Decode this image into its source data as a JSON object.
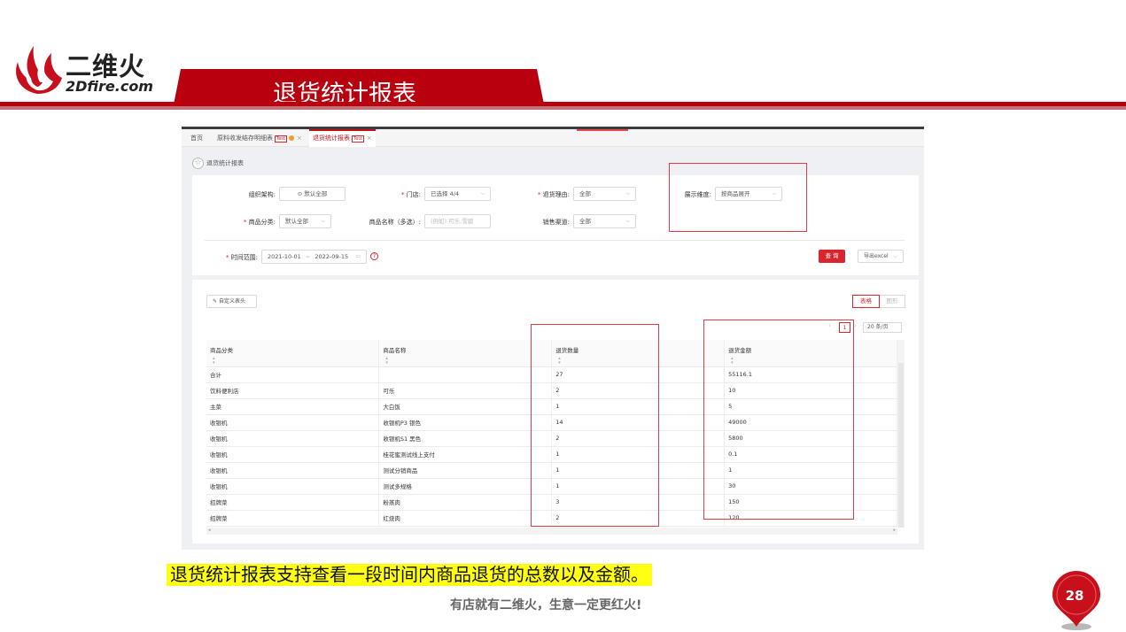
{
  "brand": {
    "name_cn": "二维火",
    "name_en": "2Dfire.com"
  },
  "slide": {
    "title": "退货统计报表",
    "caption": "退货统计报表支持查看一段时间内商品退货的总数以及金额。",
    "slogan": "有店就有二维火，生意一定更红火!",
    "page": "28"
  },
  "colors": {
    "brand_red": "#b8000e",
    "accent_red": "#d7262f",
    "highlight_yellow": "#ffff14"
  },
  "screen": {
    "tabs": [
      {
        "label": "首页"
      },
      {
        "label": "原料收发结存明细表",
        "tag": "Test"
      },
      {
        "label": "退货统计报表",
        "tag": "Test"
      }
    ],
    "breadcrumb": "退货统计报表",
    "filters": {
      "org_label": "组织架构:",
      "org_value": "⊙ 默认全部",
      "store_label": "门店:",
      "store_value": "已选择 4/4",
      "reason_label": "退货理由:",
      "reason_value": "全部",
      "dimension_label": "展示维度:",
      "dimension_value": "按商品展开",
      "category_label": "商品分类:",
      "category_value": "默认全部",
      "name_label": "商品名称（多选）:",
      "name_placeholder": "(例如) 可乐;雪碧",
      "channel_label": "销售渠道:",
      "channel_value": "全部",
      "time_label": "时间范围:",
      "date_start": "2021-10-01",
      "date_sep": "~",
      "date_end": "2022-09-15",
      "query_btn": "查 询",
      "export_btn": "导出excel"
    },
    "toolbar": {
      "custom_header": "自定义表头",
      "view_table": "表格",
      "view_chart": "图形"
    },
    "pager": {
      "current": "1",
      "page_size": "20 条/页"
    },
    "table": {
      "columns": [
        "商品分类",
        "商品名称",
        "退货数量",
        "退货金额"
      ],
      "rows": [
        [
          "合计",
          "",
          "27",
          "55116.1"
        ],
        [
          "饮料便利店",
          "可乐",
          "2",
          "10"
        ],
        [
          "主菜",
          "大白饭",
          "1",
          "5"
        ],
        [
          "收银机",
          "收银机P3 银色",
          "14",
          "49000"
        ],
        [
          "收银机",
          "收银机S1 黑色",
          "2",
          "5800"
        ],
        [
          "收银机",
          "桂花蜜测试线上支付",
          "1",
          "0.1"
        ],
        [
          "收银机",
          "测试分销商品",
          "1",
          "1"
        ],
        [
          "收银机",
          "测试多规格",
          "1",
          "30"
        ],
        [
          "招牌菜",
          "粉蒸肉",
          "3",
          "150"
        ],
        [
          "招牌菜",
          "红烧肉",
          "2",
          "120"
        ]
      ]
    }
  },
  "icons": {
    "logo": "flame-logo-icon",
    "star": "star-icon",
    "help": "help-circle-icon",
    "edit": "edit-icon"
  }
}
